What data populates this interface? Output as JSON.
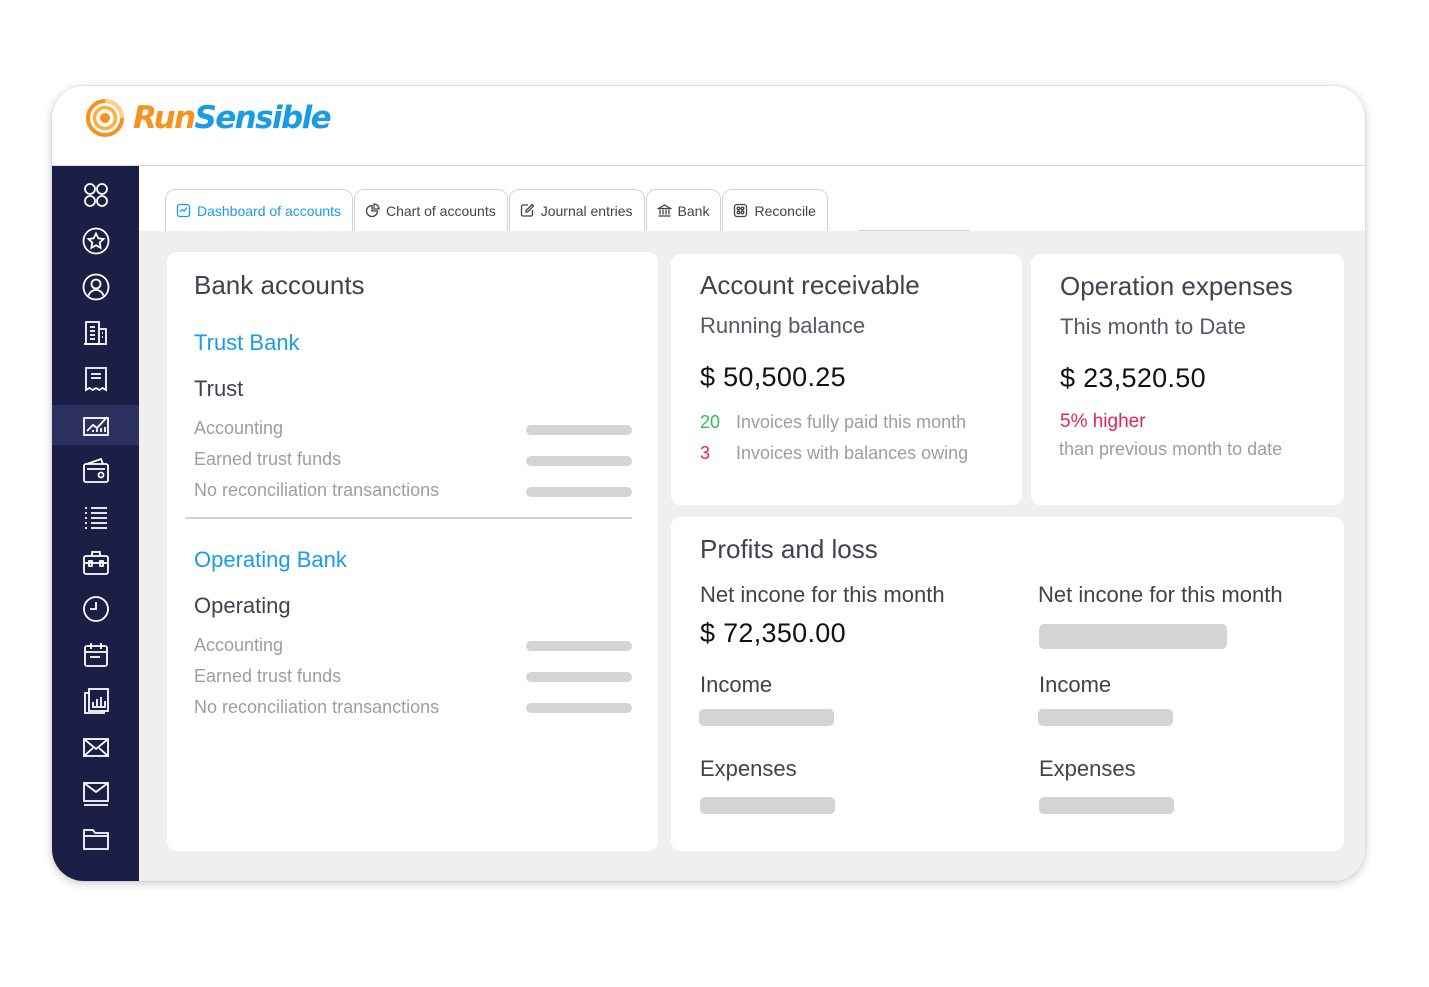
{
  "brand": {
    "name_part1": "Run",
    "name_part2": "Sensible",
    "colors": {
      "orange": "#f6921e",
      "blue": "#1a9be6"
    }
  },
  "sidebar": {
    "items": [
      {
        "icon": "apps-grid-icon"
      },
      {
        "icon": "star-badge-icon"
      },
      {
        "icon": "contact-icon"
      },
      {
        "icon": "building-icon"
      },
      {
        "icon": "receipt-icon"
      },
      {
        "icon": "accounting-chart-icon",
        "active": true
      },
      {
        "icon": "wallet-icon"
      },
      {
        "icon": "list-icon"
      },
      {
        "icon": "briefcase-icon"
      },
      {
        "icon": "clock-icon"
      },
      {
        "icon": "calendar-icon"
      },
      {
        "icon": "reports-icon"
      },
      {
        "icon": "mail-icon"
      },
      {
        "icon": "inbox-mail-icon"
      },
      {
        "icon": "folder-icon"
      }
    ]
  },
  "tabs": [
    {
      "label": "Dashboard of accounts",
      "icon": "dashboard-icon",
      "active": true
    },
    {
      "label": "Chart of accounts",
      "icon": "pie-chart-icon"
    },
    {
      "label": "Journal entries",
      "icon": "edit-icon"
    },
    {
      "label": "Bank",
      "icon": "bank-icon"
    },
    {
      "label": "Reconcile",
      "icon": "reconcile-icon"
    }
  ],
  "bank_accounts": {
    "title": "Bank accounts",
    "trust": {
      "name": "Trust Bank",
      "type": "Trust",
      "rows": [
        "Accounting",
        "Earned trust funds",
        "No reconciliation transanctions"
      ]
    },
    "operating": {
      "name": "Operating Bank",
      "type": "Operating",
      "rows": [
        "Accounting",
        "Earned trust funds",
        "No reconciliation transanctions"
      ]
    }
  },
  "receivable": {
    "title": "Account receivable",
    "subtitle": "Running balance",
    "amount": "$ 50,500.25",
    "paid_count": "20",
    "paid_label": "Invoices fully paid this month",
    "owing_count": "3",
    "owing_label": "Invoices with balances owing"
  },
  "expenses": {
    "title": "Operation expenses",
    "subtitle": "This month to Date",
    "amount": "$ 23,520.50",
    "change": "5% higher",
    "change_note": "than previous month to date"
  },
  "profits": {
    "title": "Profits and loss",
    "left": {
      "label": "Net incone for this month",
      "amount": "$ 72,350.00",
      "income": "Income",
      "expenses": "Expenses"
    },
    "right": {
      "label": "Net incone for this month",
      "income": "Income",
      "expenses": "Expenses"
    }
  }
}
